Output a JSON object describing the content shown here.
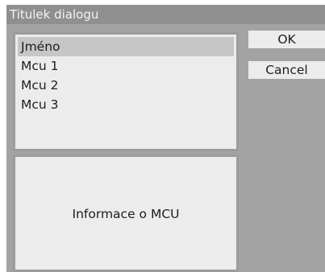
{
  "dialog": {
    "title": "Titulek dialogu"
  },
  "list": {
    "items": [
      {
        "label": "Jméno",
        "selected": true
      },
      {
        "label": "Mcu 1",
        "selected": false
      },
      {
        "label": "Mcu 2",
        "selected": false
      },
      {
        "label": "Mcu 3",
        "selected": false
      }
    ]
  },
  "info": {
    "text": "Informace o MCU"
  },
  "buttons": {
    "ok_label": "OK",
    "cancel_label": "Cancel"
  },
  "colors": {
    "dialog_background": "#a3a3a3",
    "title_bar": "#8f8f8f",
    "panel_background": "#ececec",
    "selection": "#c6c6c6"
  }
}
